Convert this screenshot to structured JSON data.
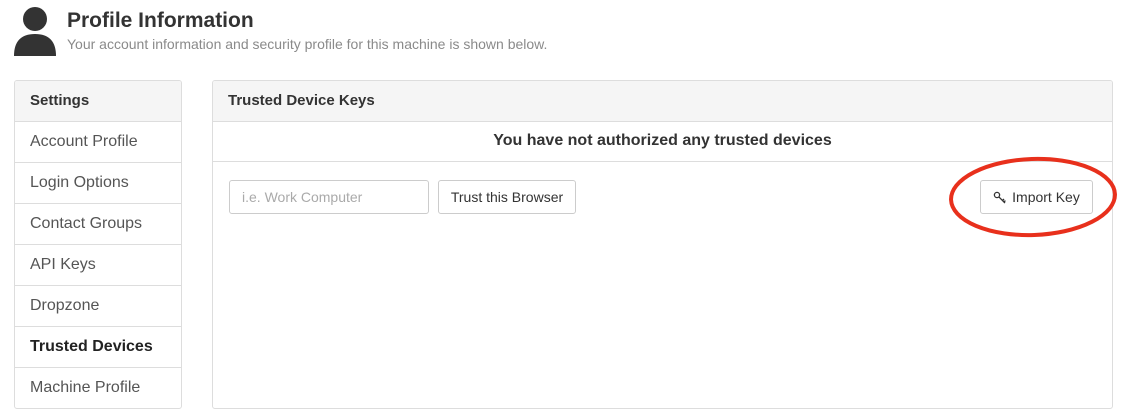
{
  "header": {
    "title": "Profile Information",
    "subtitle": "Your account information and security profile for this machine is shown below.",
    "icon": "user-icon"
  },
  "sidebar": {
    "heading": "Settings",
    "items": [
      {
        "label": "Account Profile",
        "active": false
      },
      {
        "label": "Login Options",
        "active": false
      },
      {
        "label": "Contact Groups",
        "active": false
      },
      {
        "label": "API Keys",
        "active": false
      },
      {
        "label": "Dropzone",
        "active": false
      },
      {
        "label": "Trusted Devices",
        "active": true
      },
      {
        "label": "Machine Profile",
        "active": false
      }
    ]
  },
  "panel": {
    "heading": "Trusted Device Keys",
    "notice": "You have not authorized any trusted devices",
    "device_name_placeholder": "i.e. Work Computer",
    "device_name_value": "",
    "trust_button_label": "Trust this Browser",
    "import_button_label": "Import Key",
    "import_button_icon": "key-icon"
  },
  "colors": {
    "annotation": "#e8301c",
    "border": "#dddddd",
    "heading_bg": "#f5f5f5"
  }
}
